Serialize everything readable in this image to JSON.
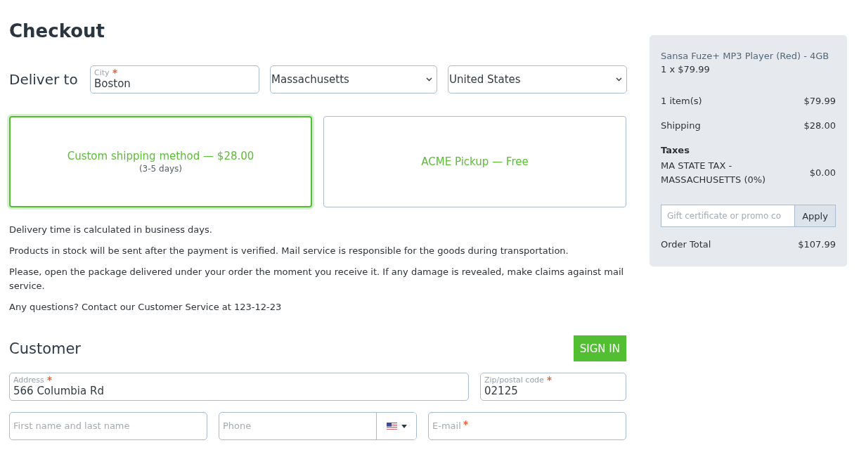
{
  "page": {
    "title": "Checkout"
  },
  "delivery": {
    "label": "Deliver to",
    "city": {
      "label": "City",
      "required": true,
      "value": "Boston"
    },
    "state": {
      "value": "Massachusetts"
    },
    "country": {
      "value": "United States"
    }
  },
  "shipping_methods": [
    {
      "label": "Custom shipping method — $28.00",
      "note": "(3-5 days)",
      "selected": true
    },
    {
      "label": "ACME Pickup — Free",
      "selected": false
    }
  ],
  "notes": [
    "Delivery time is calculated in business days.",
    "Products in stock will be sent after the payment is verified. Mail service is responsible for the goods during transportation.",
    "Please, open the package delivered under your order the moment you receive it. If any damage is revealed, make claims against mail service.",
    "Any questions? Contact our Customer Service at 123-12-23"
  ],
  "customer": {
    "title": "Customer",
    "sign_in_button": "SIGN IN",
    "fields": [
      {
        "kind": "text",
        "label": "Address",
        "required": true,
        "value": "566 Columbia Rd"
      },
      {
        "kind": "text",
        "label": "Zip/postal code",
        "required": true,
        "value": "02125"
      },
      {
        "kind": "text",
        "placeholder": "First name and last name",
        "required": false
      },
      {
        "kind": "phone",
        "placeholder": "Phone",
        "required": false
      },
      {
        "kind": "text",
        "placeholder": "E-mail",
        "required": true
      }
    ]
  },
  "summary": {
    "product": {
      "name": "Sansa Fuze+ MP3 Player (Red) - 4GB",
      "quantity": "1 x $79.99"
    },
    "lines": [
      {
        "label": "1 item(s)",
        "value": "$79.99"
      },
      {
        "label": "Shipping",
        "value": "$28.00"
      }
    ],
    "taxes": {
      "title": "Taxes",
      "lines": [
        {
          "label": "MA STATE TAX - MASSACHUSETTS (0%)",
          "value": "$0.00"
        }
      ]
    },
    "promo": {
      "placeholder": "Gift certificate or promo co",
      "button": "Apply"
    },
    "total": {
      "label": "Order Total",
      "value": "$107.99"
    }
  }
}
